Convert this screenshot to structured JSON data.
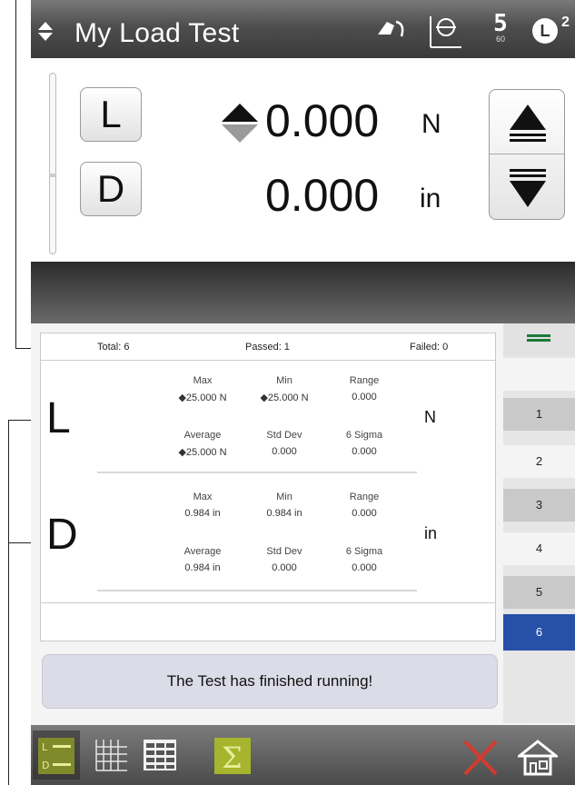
{
  "header": {
    "title": "My Load Test",
    "rate_value": "5",
    "rate_sub": "60",
    "level_letter": "L",
    "level_sup": "2"
  },
  "readout": {
    "load_button": "L",
    "disp_button": "D",
    "load_value": "0.000",
    "load_unit": "N",
    "disp_value": "0.000",
    "disp_unit": "in"
  },
  "summary": {
    "total": "Total: 6",
    "passed": "Passed: 1",
    "failed": "Failed: 0"
  },
  "stats": {
    "load": {
      "letter": "L",
      "unit": "N",
      "max_label": "Max",
      "max": "25.000 N",
      "min_label": "Min",
      "min": "25.000 N",
      "range_label": "Range",
      "range": "0.000",
      "avg_label": "Average",
      "avg": "25.000 N",
      "std_label": "Std Dev",
      "std": "0.000",
      "sigma_label": "6 Sigma",
      "sigma": "0.000"
    },
    "disp": {
      "letter": "D",
      "unit": "in",
      "max_label": "Max",
      "max": "0.984 in",
      "min_label": "Min",
      "min": "0.984 in",
      "range_label": "Range",
      "range": "0.000",
      "avg_label": "Average",
      "avg": "0.984 in",
      "std_label": "Std Dev",
      "std": "0.000",
      "sigma_label": "6 Sigma",
      "sigma": "0.000"
    }
  },
  "message": "The Test has finished running!",
  "specimens": [
    "1",
    "2",
    "3",
    "4",
    "5",
    "6"
  ],
  "specimen_active": "6",
  "colors": {
    "active_specimen": "#2750a8",
    "toolbar_accent": "#b7c93a",
    "cancel": "#d33b2f"
  },
  "toolbar": {
    "icons": [
      "load-displacement-icon",
      "graph-icon",
      "table-icon",
      "sigma-icon",
      "cancel-icon",
      "home-icon"
    ]
  }
}
